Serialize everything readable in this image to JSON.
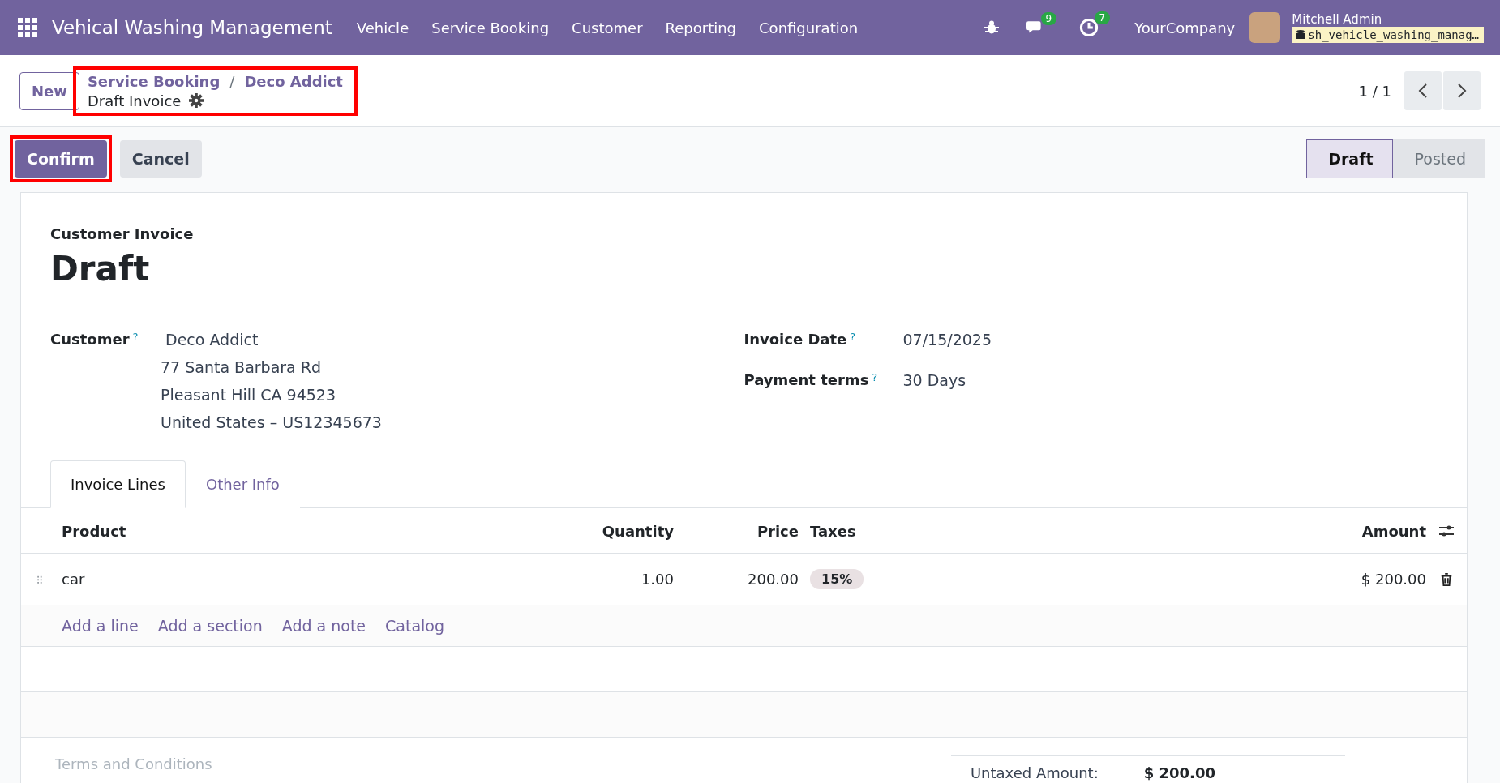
{
  "navbar": {
    "app_title": "Vehical Washing Management",
    "menu": [
      "Vehicle",
      "Service Booking",
      "Customer",
      "Reporting",
      "Configuration"
    ],
    "messages_badge": "9",
    "activities_badge": "7",
    "company": "YourCompany",
    "user_name": "Mitchell Admin",
    "database": "sh_vehicle_washing_manag…"
  },
  "control_panel": {
    "new_button": "New",
    "breadcrumbs": [
      "Service Booking",
      "Deco Addict"
    ],
    "breadcrumb_separator": "/",
    "current": "Draft Invoice",
    "highlighted": true,
    "pager": "1 / 1"
  },
  "action_buttons": [
    {
      "label": "Confirm",
      "kind": "primary",
      "highlighted": true
    },
    {
      "label": "Cancel",
      "kind": "secondary",
      "highlighted": false
    }
  ],
  "status_stages": [
    {
      "label": "Draft",
      "selected": true
    },
    {
      "label": "Posted",
      "selected": false
    }
  ],
  "form": {
    "subtitle": "Customer Invoice",
    "title": "Draft",
    "customer": {
      "label": "Customer",
      "help": "?",
      "name": "Deco Addict",
      "address": [
        "77 Santa Barbara Rd",
        "Pleasant Hill CA 94523",
        "United States – US12345673"
      ]
    },
    "right_fields": [
      {
        "label": "Invoice Date",
        "help": "?",
        "value": "07/15/2025"
      },
      {
        "label": "Payment terms",
        "help": "?",
        "value": "30 Days"
      }
    ]
  },
  "tabs": [
    {
      "label": "Invoice Lines",
      "selected": true
    },
    {
      "label": "Other Info",
      "selected": false
    }
  ],
  "table": {
    "columns": [
      "Product",
      "Quantity",
      "Price",
      "Taxes",
      "Amount"
    ],
    "rows": [
      {
        "product": "car",
        "quantity": "1.00",
        "price": "200.00",
        "taxes": [
          "15%"
        ],
        "amount": "$ 200.00"
      }
    ],
    "add_links": [
      "Add a line",
      "Add a section",
      "Add a note",
      "Catalog"
    ]
  },
  "terms_placeholder": "Terms and Conditions",
  "totals": [
    {
      "label": "Untaxed Amount:",
      "value": "$ 200.00"
    }
  ]
}
